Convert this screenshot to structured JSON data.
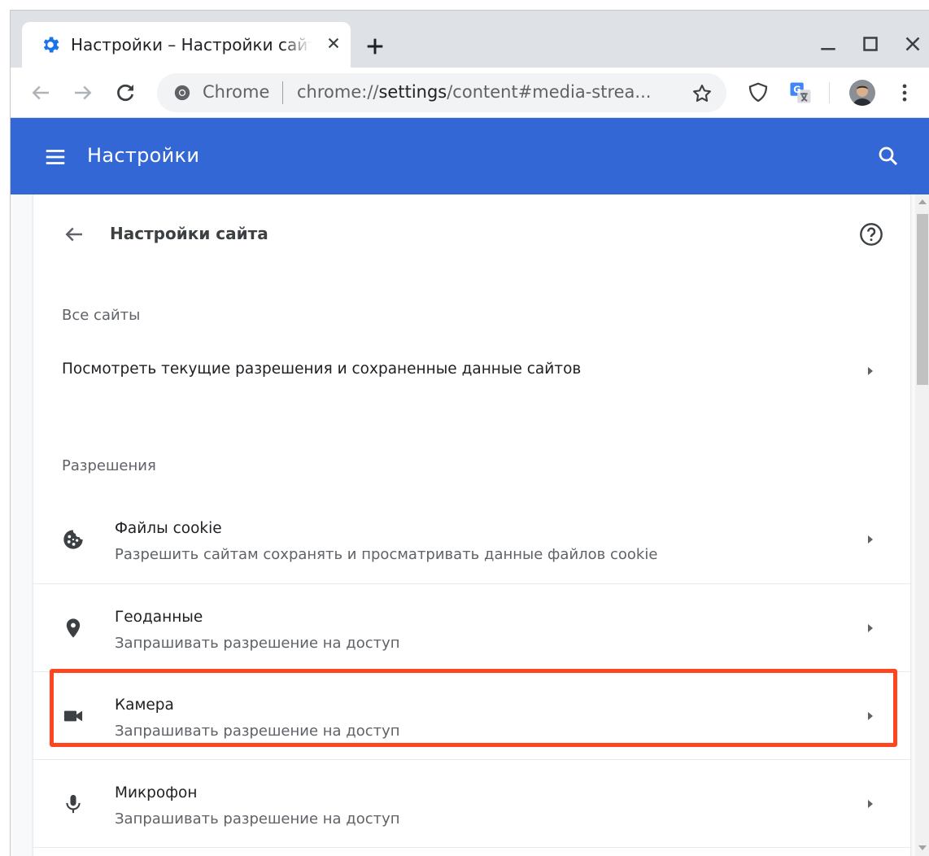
{
  "tab": {
    "title": "Настройки – Настройки сайта",
    "icon": "gear-icon"
  },
  "toolbar": {
    "omnibox_chip": "Chrome",
    "url_scheme": "chrome://",
    "url_host": "settings",
    "url_path": "/content#media-strea...",
    "icons": [
      "back-arrow-icon",
      "forward-arrow-icon",
      "reload-icon",
      "star-icon",
      "shield-extension-icon",
      "translate-extension-icon",
      "profile-avatar",
      "kebab-menu-icon"
    ]
  },
  "header": {
    "title": "Настройки"
  },
  "page": {
    "title": "Настройки сайта",
    "all_sites": {
      "section_title": "Все сайты",
      "row_label": "Посмотреть текущие разрешения и сохраненные данные сайтов"
    },
    "permissions": {
      "section_title": "Разрешения",
      "items": [
        {
          "title": "Файлы cookie",
          "subtitle": "Разрешить сайтам сохранять и просматривать данные файлов cookie",
          "icon": "cookie-icon"
        },
        {
          "title": "Геоданные",
          "subtitle": "Запрашивать разрешение на доступ",
          "icon": "location-pin-icon"
        },
        {
          "title": "Камера",
          "subtitle": "Запрашивать разрешение на доступ",
          "icon": "camera-icon",
          "highlighted": true
        },
        {
          "title": "Микрофон",
          "subtitle": "Запрашивать разрешение на доступ",
          "icon": "microphone-icon"
        }
      ]
    }
  },
  "colors": {
    "header_blue": "#3367d6",
    "highlight_red": "#ff4420"
  }
}
